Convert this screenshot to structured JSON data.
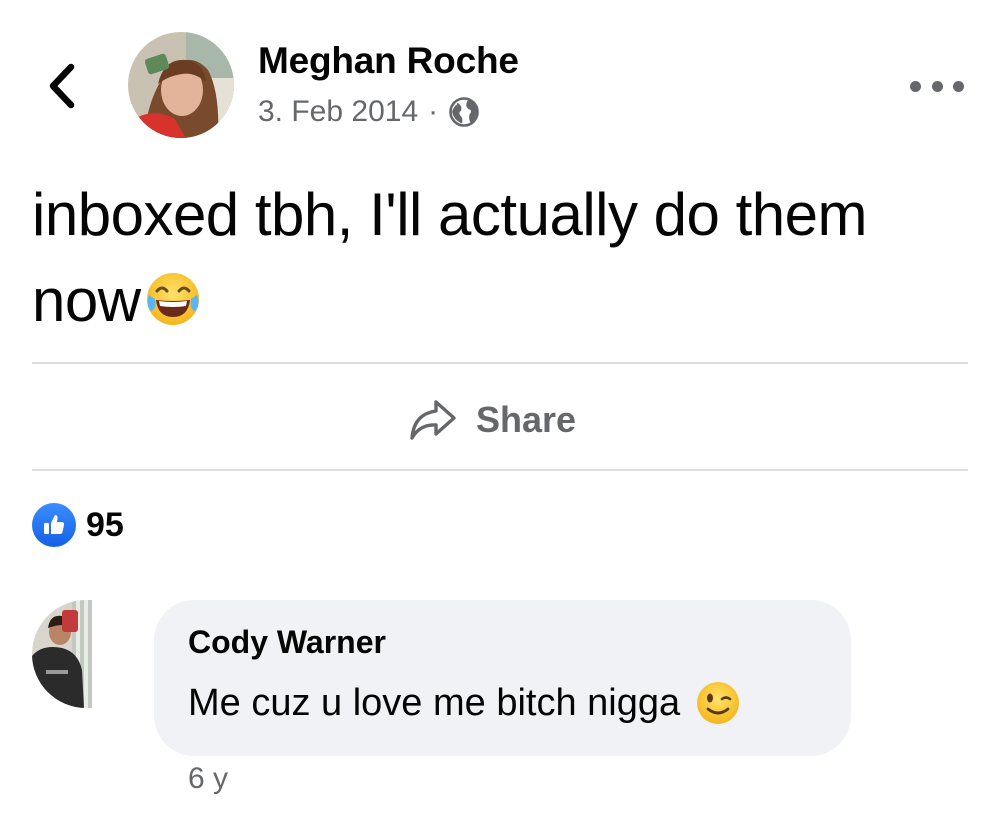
{
  "post": {
    "author": "Meghan Roche",
    "date": "3. Feb 2014",
    "separator": "·",
    "audience_icon": "globe-icon",
    "text_line1": "inboxed tbh, I'll actually do them",
    "text_line2": "now",
    "text_emoji": "face-with-tears-of-joy-emoji"
  },
  "actions": {
    "share_label": "Share"
  },
  "reactions": {
    "type": "like",
    "count": "95"
  },
  "comments": [
    {
      "author": "Cody Warner",
      "text": "Me cuz u love me bitch nigga",
      "emoji": "winking-face-emoji",
      "time": "6 y"
    }
  ],
  "colors": {
    "text_primary": "#050505",
    "text_secondary": "#65676b",
    "divider": "#dadde1",
    "bubble": "#f0f2f5",
    "like_blue": "#1877f2"
  }
}
